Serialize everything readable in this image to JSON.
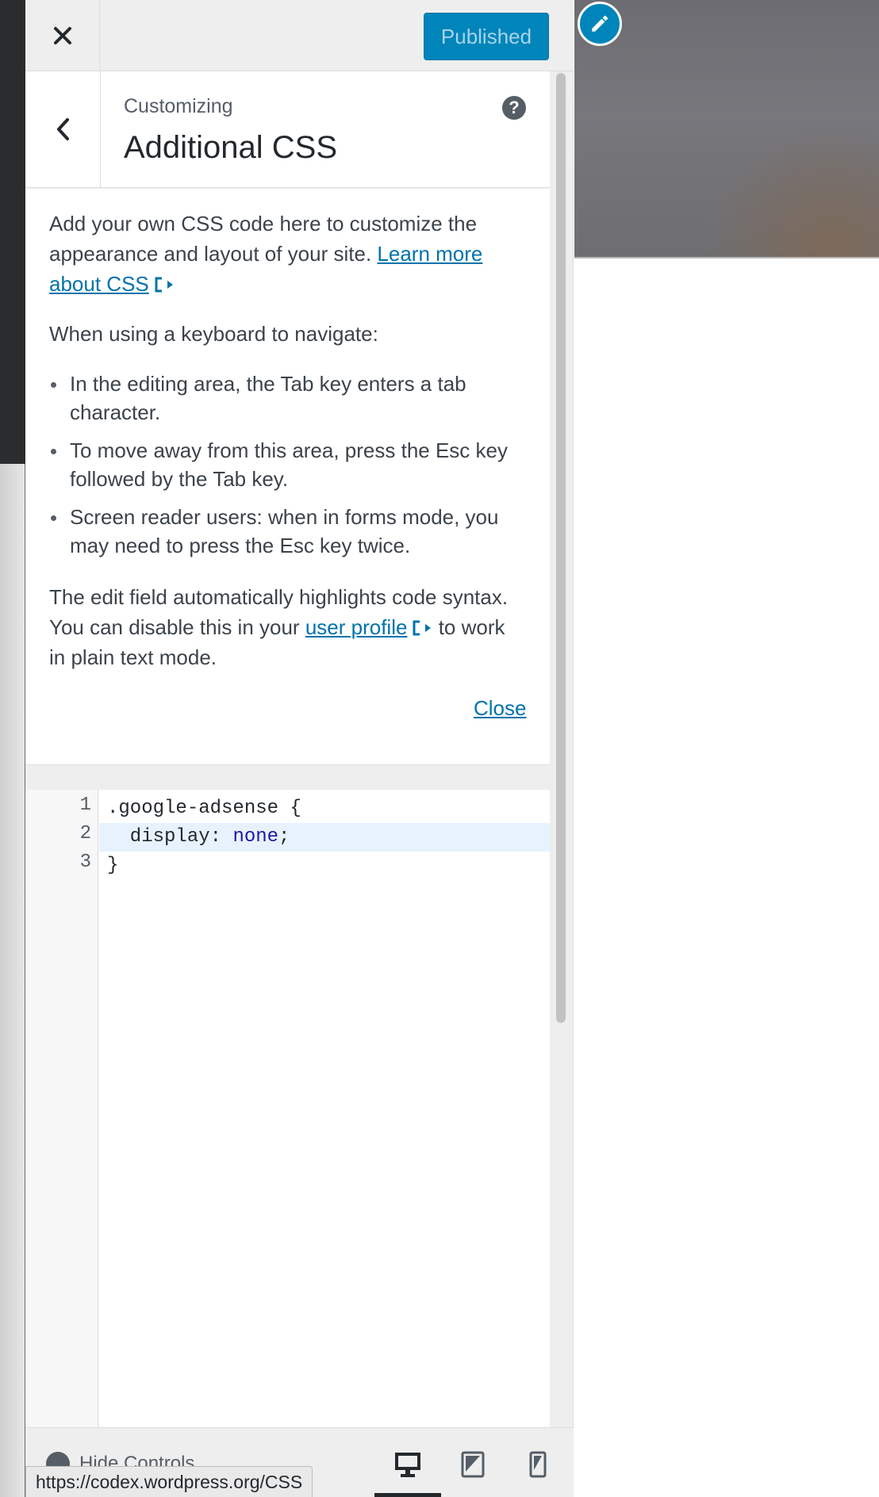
{
  "header": {
    "publish_label": "Published"
  },
  "section": {
    "parent_label": "Customizing",
    "title": "Additional CSS"
  },
  "description": {
    "intro_text": "Add your own CSS code here to customize the appearance and layout of your site.",
    "learn_more_link": "Learn more about CSS",
    "keyboard_heading": "When using a keyboard to navigate:",
    "keyboard_tips": [
      "In the editing area, the Tab key enters a tab character.",
      "To move away from this area, press the Esc key followed by the Tab key.",
      "Screen reader users: when in forms mode, you may need to press the Esc key twice."
    ],
    "syntax_text_before": "The edit field automatically highlights code syntax. You can disable this in your",
    "user_profile_link": "user profile",
    "syntax_text_after": "to work in plain text mode.",
    "close_label": "Close"
  },
  "editor": {
    "line_numbers": [
      "1",
      "2",
      "3"
    ],
    "lines": [
      ".google-adsense {",
      "  display: ",
      "}"
    ],
    "line2_value": "none",
    "line2_end": ";",
    "active_line": 2
  },
  "footer": {
    "hide_controls_label": "Hide Controls",
    "devices": [
      "desktop",
      "tablet",
      "mobile"
    ],
    "active_device": "desktop"
  },
  "status_bar": {
    "url": "https://codex.wordpress.org/CSS"
  },
  "colors": {
    "accent": "#0085ba",
    "link": "#0073aa",
    "active_line": "#e8f2fe"
  },
  "icons": {
    "close": "close-icon",
    "back": "chevron-left-icon",
    "help": "help-icon",
    "external": "external-link-icon",
    "edit": "pencil-icon"
  }
}
